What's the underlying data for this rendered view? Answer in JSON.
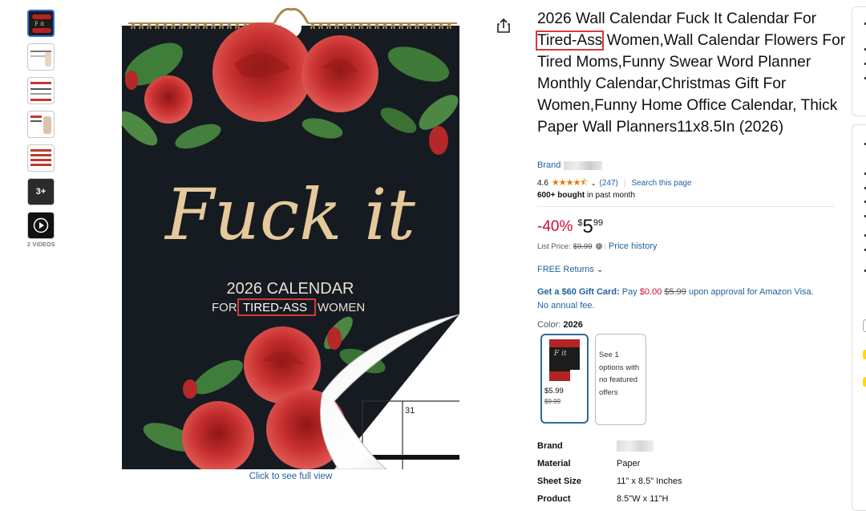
{
  "thumbnails": {
    "videos_label": "2 VIDEOS",
    "more_label": "3+"
  },
  "image": {
    "cover_title": "Fuck it",
    "cover_line1": "2026 CALENDAR",
    "cover_for": "FOR",
    "cover_highlight": "TIRED-ASS",
    "cover_women": "WOMEN",
    "page_day": "31",
    "see_full_view": "Click to see full view"
  },
  "product": {
    "title_before": "2026 Wall Calendar Fuck It Calendar For ",
    "title_highlight": "Tired-Ass",
    "title_after": " Women,Wall Calendar Flowers For Tired Moms,Funny Swear Word Planner Monthly Calendar,Christmas Gift For Women,Funny Home Office Calendar, Thick Paper Wall Planners11x8.5In (2026)",
    "brand_label": "Brand",
    "rating": "4.6",
    "stars_display": "★★★★⯪",
    "review_count": "(247)",
    "search_page": "Search this page",
    "bought_bold": "600+ bought",
    "bought_rest": " in past month"
  },
  "pricing": {
    "discount": "-40%",
    "currency": "$",
    "whole": "5",
    "fraction": "99",
    "list_label": "List Price:",
    "list_price": "$9.99",
    "price_history": "Price history",
    "returns": "FREE Returns"
  },
  "gift_card": {
    "bold": "Get a $60 Gift Card:",
    "pay": " Pay ",
    "pay_amount": "$0.00",
    "old_price": "$5.99",
    "rest": " upon approval for Amazon Visa. No annual fee."
  },
  "color": {
    "label": "Color:",
    "value": "2026",
    "swatch_price": "$5.99",
    "swatch_list": "$9.99",
    "other_options": "See 1 options with no featured offers"
  },
  "specs": [
    {
      "key": "Brand",
      "value": ""
    },
    {
      "key": "Material",
      "value": "Paper"
    },
    {
      "key": "Sheet Size",
      "value": "11\" x 8.5\" Inches"
    },
    {
      "key": "Product",
      "value": "8.5\"W x 11\"H"
    }
  ],
  "colors": {
    "link": "#2162a1",
    "discount": "#cc0c39",
    "highlight_box": "#d23c3c",
    "calendar_bg": "#161b22",
    "rose": "#c62f2f",
    "gold": "#e6c99a"
  }
}
